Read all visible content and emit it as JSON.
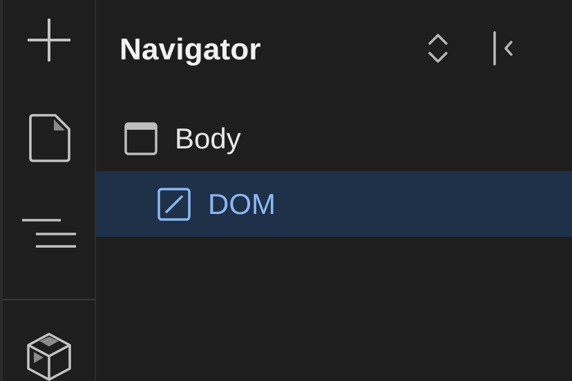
{
  "toolbar": {
    "tools": [
      {
        "id": "add",
        "icon": "plus-icon"
      },
      {
        "id": "pages",
        "icon": "page-icon"
      },
      {
        "id": "navigator",
        "icon": "navigator-lines-icon"
      },
      {
        "id": "components",
        "icon": "cube-icon"
      }
    ]
  },
  "panel": {
    "title": "Navigator",
    "actions": [
      {
        "id": "expand-collapse-all",
        "icon": "chevron-up-down-icon"
      },
      {
        "id": "close-panel",
        "icon": "collapse-left-icon"
      }
    ]
  },
  "tree": {
    "items": [
      {
        "label": "Body",
        "icon": "body-element-icon",
        "depth": 0,
        "selected": false
      },
      {
        "label": "DOM",
        "icon": "dom-element-icon",
        "depth": 1,
        "selected": true
      }
    ]
  },
  "colors": {
    "background": "#1e1e1e",
    "selected_row": "#1f3049",
    "selected_text": "#8ab8f0",
    "text": "#e8e8e8",
    "icon": "#bdbdbd"
  }
}
